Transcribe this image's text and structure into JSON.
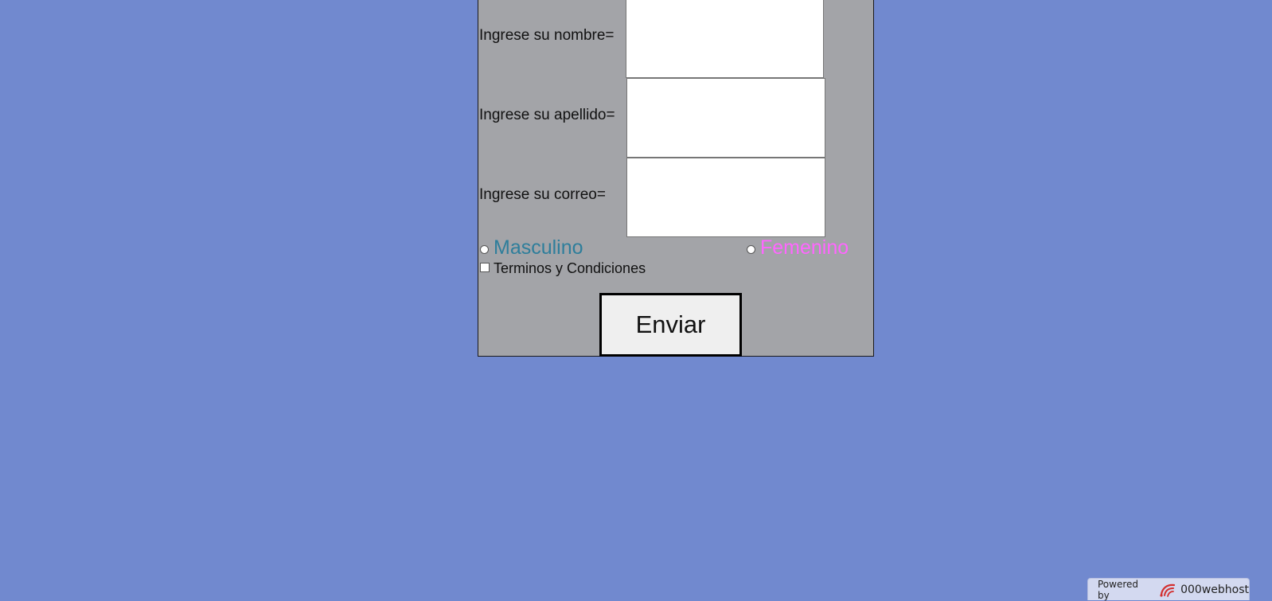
{
  "form": {
    "fields": [
      {
        "label": "Ingrese su nombre=",
        "value": ""
      },
      {
        "label": "Ingrese su apellido=",
        "value": ""
      },
      {
        "label": "Ingrese su correo=",
        "value": ""
      }
    ],
    "gender": {
      "male_label": "Masculino",
      "female_label": "Femenino",
      "male_color": "#2e7e9b",
      "female_color": "#ff66ff"
    },
    "terms_label": "Terminos y Condiciones",
    "submit_label": "Enviar"
  },
  "footer": {
    "powered_by": "Powered by",
    "brand": "000webhost",
    "brand_icon": "000webhost-logo-icon"
  }
}
